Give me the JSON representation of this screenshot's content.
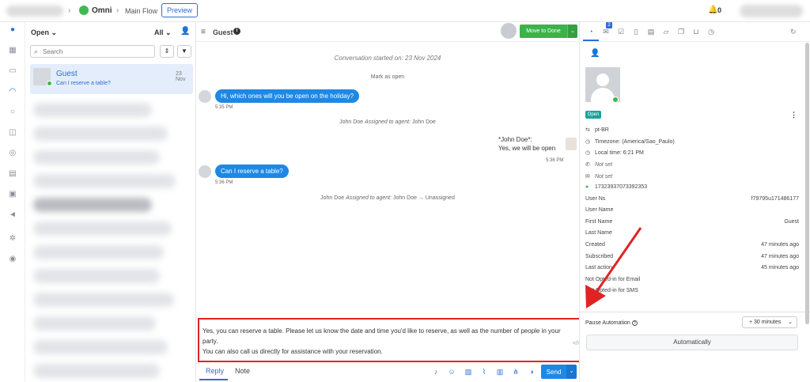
{
  "topbar": {
    "app_name": "Omni",
    "flow_name": "Main Flow",
    "preview_label": "Preview",
    "notification_count": "0"
  },
  "conversation_list": {
    "filter_label": "Open",
    "scope_label": "All",
    "search_placeholder": "Search",
    "active_item": {
      "name": "Guest",
      "preview": "Can I reserve a table?",
      "date": "23 Nov"
    }
  },
  "chat": {
    "contact_name": "Guest",
    "move_to_done_label": "Move to Done",
    "started_text": "Conversation started on: 23 Nov 2024",
    "mark_open_text": "Mark as open",
    "messages": [
      {
        "text": "Hi, which ones will you be open on the holiday?",
        "time": "5:35 PM"
      },
      {
        "agent_name": "*John Doe*:",
        "text": "Yes, we will be open",
        "time": "5:36 PM"
      },
      {
        "text": "Can I reserve a table?",
        "time": "5:36 PM"
      }
    ],
    "assignment_1": {
      "actor": "John Doe",
      "action": "Assigned to agent:",
      "target": "John Doe"
    },
    "assignment_2": {
      "actor": "John Doe",
      "action": "Assigned to agent:",
      "target": "John Doe → Unassigned"
    }
  },
  "composer": {
    "text_line1": "Yes, you can reserve a table. Please let us know the date and time you'd like to reserve, as well as the number of people in your party.",
    "text_line2": "You can also call us directly for assistance with your reservation.",
    "code_glyph": "</>",
    "reply_tab": "Reply",
    "note_tab": "Note",
    "send_label": "Send"
  },
  "contact_panel": {
    "tab_badge": "2",
    "status": "Open",
    "language": "pt-BR",
    "timezone_label": "Timezone:",
    "timezone_value": "(America/Sao_Paulo)",
    "local_time_label": "Local time:",
    "local_time_value": "6:21 PM",
    "phone": "Not set",
    "email": "Not set",
    "whatsapp_id": "17323937073392353",
    "fields": [
      {
        "label": "User Ns",
        "value": "f79795u171486177"
      },
      {
        "label": "User Name",
        "value": ""
      },
      {
        "label": "First Name",
        "value": "Guest"
      },
      {
        "label": "Last Name",
        "value": ""
      },
      {
        "label": "Created",
        "value": "47 minutes ago"
      },
      {
        "label": "Subscribed",
        "value": "47 minutes ago"
      },
      {
        "label": "Last action",
        "value": "45 minutes ago"
      },
      {
        "label": "Not Opted-in for Email",
        "value": ""
      },
      {
        "label": "Not Opted-in for SMS",
        "value": ""
      }
    ],
    "pause_automation_label": "Pause Automation",
    "pause_duration": "+ 30 minutes",
    "automatically_label": "Automatically"
  },
  "colors": {
    "accent": "#2f6fd6",
    "bubble": "#1e88e5",
    "done_button": "#3bb34a",
    "highlight": "#e02424"
  }
}
